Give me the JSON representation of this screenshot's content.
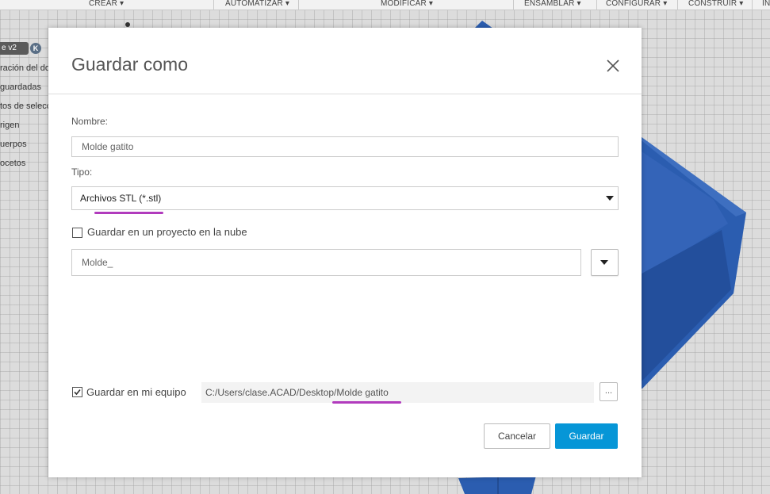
{
  "toolbar": {
    "items": [
      "CREAR ▾",
      "AUTOMATIZAR ▾",
      "MODIFICAR ▾",
      "ENSAMBLAR ▾",
      "CONFIGURAR ▾",
      "CONSTRUIR ▾",
      "IN"
    ]
  },
  "browser": {
    "doc_tab": "e v2",
    "items": [
      "ración del do",
      "guardadas",
      "tos de selecc",
      "rigen",
      "uerpos",
      "ocetos"
    ]
  },
  "model": {
    "color": "#2b5db0"
  },
  "dialog": {
    "title": "Guardar como",
    "name_label": "Nombre:",
    "name_value": "Molde gatito",
    "type_label": "Tipo:",
    "type_value": "Archivos STL (*.stl)",
    "cloud_checkbox_label": "Guardar en un proyecto en la nube",
    "cloud_checked": false,
    "project_value": "Molde_",
    "local_checkbox_label": "Guardar en mi equipo",
    "local_checked": true,
    "path_value": "C:/Users/clase.ACAD/Desktop/Molde gatito",
    "browse_label": "...",
    "cancel_label": "Cancelar",
    "save_label": "Guardar"
  },
  "colors": {
    "accent": "#0696d7",
    "highlight_underline": "#b13bbd"
  }
}
